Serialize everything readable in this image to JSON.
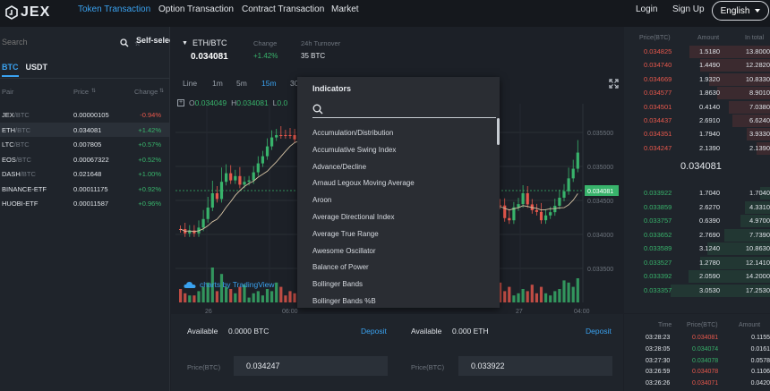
{
  "nav": {
    "logo": "JEX",
    "items": [
      "Token Transaction",
      "Option Transaction",
      "Contract Transaction",
      "Market"
    ],
    "login": "Login",
    "signup": "Sign Up",
    "language": "English"
  },
  "left": {
    "search_placeholder": "Search",
    "self_select": "Self-selecte",
    "tabs": [
      "BTC",
      "USDT"
    ],
    "head": {
      "pair": "Pair",
      "price": "Price",
      "change": "Change"
    },
    "pairs": [
      {
        "base": "JEX",
        "quote": "/BTC",
        "price": "0.00000105",
        "change": "-0.94%",
        "dir": "down"
      },
      {
        "base": "ETH",
        "quote": "/BTC",
        "price": "0.034081",
        "change": "+1.42%",
        "dir": "up"
      },
      {
        "base": "LTC",
        "quote": "/BTC",
        "price": "0.007805",
        "change": "+0.57%",
        "dir": "up"
      },
      {
        "base": "EOS",
        "quote": "/BTC",
        "price": "0.00067322",
        "change": "+0.52%",
        "dir": "up"
      },
      {
        "base": "DASH",
        "quote": "/BTC",
        "price": "0.021648",
        "change": "+1.00%",
        "dir": "up"
      },
      {
        "base": "BINANCE-ETF",
        "quote": "",
        "price": "0.00011175",
        "change": "+0.92%",
        "dir": "up"
      },
      {
        "base": "HUOBI-ETF",
        "quote": "",
        "price": "0.00011587",
        "change": "+0.96%",
        "dir": "up"
      }
    ]
  },
  "header": {
    "pair": "ETH/BTC",
    "last_price": "0.034081",
    "change_label": "Change",
    "change_value": "+1.42%",
    "turnover_label": "24h Turnover",
    "turnover_value": "35 BTC"
  },
  "toolbar": {
    "intervals": [
      "Line",
      "1m",
      "5m",
      "15m",
      "30"
    ],
    "active": "15m"
  },
  "ohlc": {
    "o_label": "O",
    "o_val": "0.034049",
    "h_label": "H",
    "h_val": "0.034081",
    "l_label": "L",
    "l_val": "0.0"
  },
  "tradingview": "charts by TradingView",
  "chart_data": {
    "type": "candlestick",
    "price_axis": [
      "0.035500",
      "0.035000",
      "0.034500",
      "0.034000",
      "0.033500"
    ],
    "current_price_label": "0.034081",
    "time_axis": [
      "26",
      "06:00",
      "27",
      "04:00"
    ],
    "colors": {
      "up": "#38b36b",
      "down": "#e8584c"
    }
  },
  "indicators": {
    "title": "Indicators",
    "search_value": "",
    "items": [
      "Accumulation/Distribution",
      "Accumulative Swing Index",
      "Advance/Decline",
      "Arnaud Legoux Moving Average",
      "Aroon",
      "Average Directional Index",
      "Average True Range",
      "Awesome Oscillator",
      "Balance of Power",
      "Bollinger Bands",
      "Bollinger Bands %B"
    ]
  },
  "orderbook": {
    "head": {
      "price": "Price(BTC)",
      "amount": "Amount",
      "total": "In total"
    },
    "asks": [
      {
        "price": "0.034825",
        "amount": "1.5180",
        "total": "13.8000",
        "depth": 0.55
      },
      {
        "price": "0.034740",
        "amount": "1.4490",
        "total": "12.2820",
        "depth": 0.48
      },
      {
        "price": "0.034669",
        "amount": "1.9320",
        "total": "10.8330",
        "depth": 0.42
      },
      {
        "price": "0.034577",
        "amount": "1.8630",
        "total": "8.9010",
        "depth": 0.36
      },
      {
        "price": "0.034501",
        "amount": "0.4140",
        "total": "7.0380",
        "depth": 0.28
      },
      {
        "price": "0.034437",
        "amount": "2.6910",
        "total": "6.6240",
        "depth": 0.26
      },
      {
        "price": "0.034351",
        "amount": "1.7940",
        "total": "3.9330",
        "depth": 0.16
      },
      {
        "price": "0.034247",
        "amount": "2.1390",
        "total": "2.1390",
        "depth": 0.09
      }
    ],
    "mid": "0.034081",
    "bids": [
      {
        "price": "0.033922",
        "amount": "1.7040",
        "total": "1.7040",
        "depth": 0.07
      },
      {
        "price": "0.033859",
        "amount": "2.6270",
        "total": "4.3310",
        "depth": 0.17
      },
      {
        "price": "0.033757",
        "amount": "0.6390",
        "total": "4.9700",
        "depth": 0.2
      },
      {
        "price": "0.033652",
        "amount": "2.7690",
        "total": "7.7390",
        "depth": 0.31
      },
      {
        "price": "0.033589",
        "amount": "3.1240",
        "total": "10.8630",
        "depth": 0.43
      },
      {
        "price": "0.033527",
        "amount": "1.2780",
        "total": "12.1410",
        "depth": 0.48
      },
      {
        "price": "0.033392",
        "amount": "2.0590",
        "total": "14.2000",
        "depth": 0.56
      },
      {
        "price": "0.033357",
        "amount": "3.0530",
        "total": "17.2530",
        "depth": 0.68
      }
    ]
  },
  "forms": {
    "buy": {
      "available_label": "Available",
      "available_value": "0.0000 BTC",
      "deposit": "Deposit",
      "price_label": "Price(BTC)",
      "price_value": "0.034247"
    },
    "sell": {
      "available_label": "Available",
      "available_value": "0.000 ETH",
      "deposit": "Deposit",
      "price_label": "Price(BTC)",
      "price_value": "0.033922"
    }
  },
  "trades": {
    "head": {
      "time": "Time",
      "price": "Price(BTC)",
      "amount": "Amount"
    },
    "rows": [
      {
        "time": "03:28:23",
        "price": "0.034081",
        "amount": "0.1155",
        "dir": "down"
      },
      {
        "time": "03:28:05",
        "price": "0.034074",
        "amount": "0.0161",
        "dir": "up"
      },
      {
        "time": "03:27:30",
        "price": "0.034078",
        "amount": "0.0578",
        "dir": "up"
      },
      {
        "time": "03:26:59",
        "price": "0.034078",
        "amount": "0.1106",
        "dir": "down"
      },
      {
        "time": "03:26:26",
        "price": "0.034071",
        "amount": "0.0420",
        "dir": "down"
      }
    ]
  }
}
